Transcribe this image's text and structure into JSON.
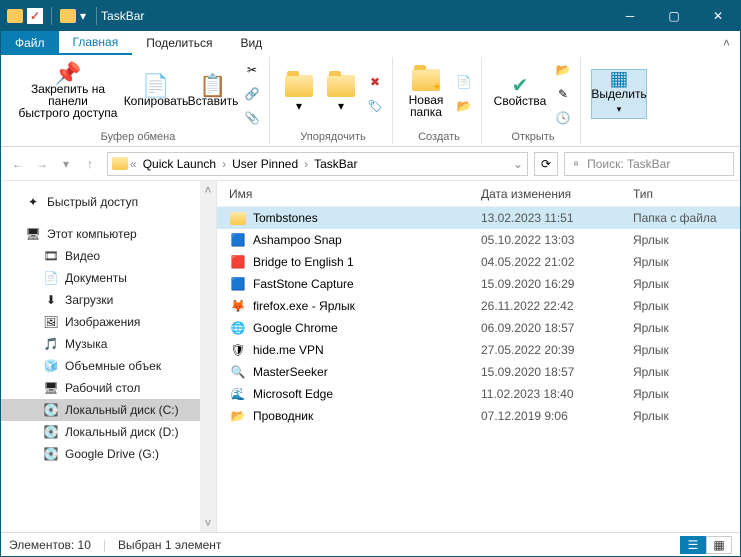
{
  "window_title": "TaskBar",
  "tabs": {
    "file": "Файл",
    "home": "Главная",
    "share": "Поделиться",
    "view": "Вид"
  },
  "ribbon": {
    "pin": "Закрепить на панели\nбыстрого доступа",
    "copy": "Копировать",
    "paste": "Вставить",
    "clipboard": "Буфер обмена",
    "organize": "Упорядочить",
    "newfolder": "Новая\nпапка",
    "create": "Создать",
    "properties": "Свойства",
    "open": "Открыть",
    "select": "Выделить"
  },
  "breadcrumbs": [
    "Quick Launch",
    "User Pinned",
    "TaskBar"
  ],
  "search_placeholder": "Поиск: TaskBar",
  "nav": {
    "quick": "Быстрый доступ",
    "pc": "Этот компьютер",
    "video": "Видео",
    "docs": "Документы",
    "downloads": "Загрузки",
    "images": "Изображения",
    "music": "Музыка",
    "volumes": "Объемные объек",
    "desktop": "Рабочий стол",
    "cdrive": "Локальный диск (C:)",
    "ddrive": "Локальный диск (D:)",
    "gdrive": "Google Drive (G:)"
  },
  "columns": {
    "name": "Имя",
    "date": "Дата изменения",
    "type": "Тип"
  },
  "files": [
    {
      "icon": "📁",
      "name": "Tombstones",
      "date": "13.02.2023 11:51",
      "type": "Папка с файла",
      "selected": true
    },
    {
      "icon": "🟦",
      "name": "Ashampoo Snap",
      "date": "05.10.2022 13:03",
      "type": "Ярлык"
    },
    {
      "icon": "🟥",
      "name": "Bridge to English 1",
      "date": "04.05.2022 21:02",
      "type": "Ярлык"
    },
    {
      "icon": "🟦",
      "name": "FastStone Capture",
      "date": "15.09.2020 16:29",
      "type": "Ярлык"
    },
    {
      "icon": "🦊",
      "name": "firefox.exe - Ярлык",
      "date": "26.11.2022 22:42",
      "type": "Ярлык"
    },
    {
      "icon": "🌐",
      "name": "Google Chrome",
      "date": "06.09.2020 18:57",
      "type": "Ярлык"
    },
    {
      "icon": "🛡",
      "name": "hide.me VPN",
      "date": "27.05.2022 20:39",
      "type": "Ярлык"
    },
    {
      "icon": "🔍",
      "name": "MasterSeeker",
      "date": "15.09.2020 18:57",
      "type": "Ярлык"
    },
    {
      "icon": "🌊",
      "name": "Microsoft Edge",
      "date": "11.02.2023 18:40",
      "type": "Ярлык"
    },
    {
      "icon": "📂",
      "name": "Проводник",
      "date": "07.12.2019 9:06",
      "type": "Ярлык"
    }
  ],
  "status": {
    "count": "Элементов: 10",
    "selected": "Выбран 1 элемент"
  }
}
